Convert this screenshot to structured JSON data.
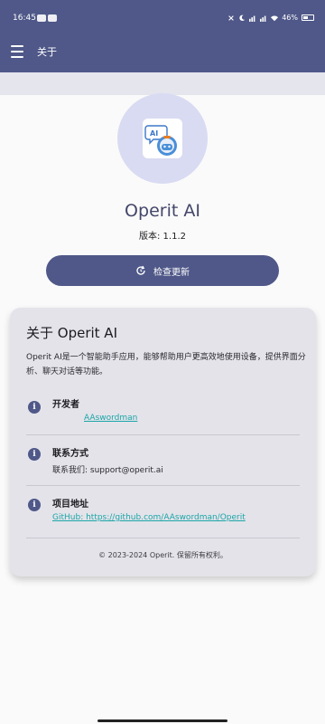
{
  "status_bar": {
    "time": "16:45",
    "battery": "46%"
  },
  "app_bar": {
    "title": "关于"
  },
  "header": {
    "app_name": "Operit AI",
    "version": "版本: 1.1.2",
    "check_update_label": "检查更新"
  },
  "about_card": {
    "title": "关于 Operit AI",
    "description": "Operit AI是一个智能助手应用，能够帮助用户更高效地使用设备，提供界面分析、聊天对话等功能。",
    "developer": {
      "label": "开发者",
      "value": "AAswordman"
    },
    "contact": {
      "label": "联系方式",
      "value": "联系我们: support@operit.ai"
    },
    "project": {
      "label": "项目地址",
      "value": "GitHub: https://github.com/AAswordman/Operit"
    },
    "footer": "© 2023-2024 Operit. 保留所有权利。"
  },
  "colors": {
    "primary": "#4f5888",
    "avatar_bg": "#d9dbf2",
    "card_bg": "#e4e3ea",
    "link": "#1aa6a6"
  }
}
